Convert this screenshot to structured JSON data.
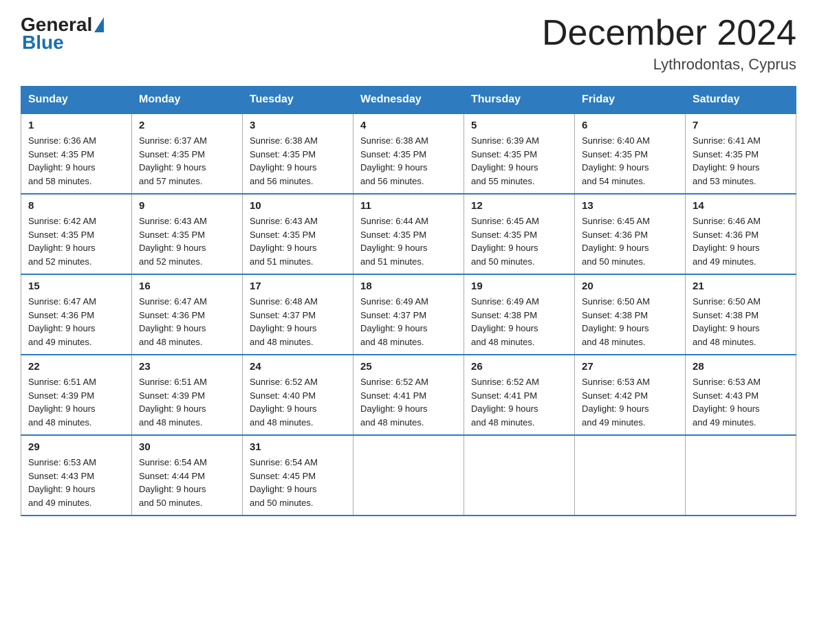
{
  "header": {
    "logo_line1": "General",
    "logo_line2": "Blue",
    "title": "December 2024",
    "subtitle": "Lythrodontas, Cyprus"
  },
  "weekdays": [
    "Sunday",
    "Monday",
    "Tuesday",
    "Wednesday",
    "Thursday",
    "Friday",
    "Saturday"
  ],
  "weeks": [
    [
      {
        "day": "1",
        "sunrise": "6:36 AM",
        "sunset": "4:35 PM",
        "daylight": "9 hours and 58 minutes."
      },
      {
        "day": "2",
        "sunrise": "6:37 AM",
        "sunset": "4:35 PM",
        "daylight": "9 hours and 57 minutes."
      },
      {
        "day": "3",
        "sunrise": "6:38 AM",
        "sunset": "4:35 PM",
        "daylight": "9 hours and 56 minutes."
      },
      {
        "day": "4",
        "sunrise": "6:38 AM",
        "sunset": "4:35 PM",
        "daylight": "9 hours and 56 minutes."
      },
      {
        "day": "5",
        "sunrise": "6:39 AM",
        "sunset": "4:35 PM",
        "daylight": "9 hours and 55 minutes."
      },
      {
        "day": "6",
        "sunrise": "6:40 AM",
        "sunset": "4:35 PM",
        "daylight": "9 hours and 54 minutes."
      },
      {
        "day": "7",
        "sunrise": "6:41 AM",
        "sunset": "4:35 PM",
        "daylight": "9 hours and 53 minutes."
      }
    ],
    [
      {
        "day": "8",
        "sunrise": "6:42 AM",
        "sunset": "4:35 PM",
        "daylight": "9 hours and 52 minutes."
      },
      {
        "day": "9",
        "sunrise": "6:43 AM",
        "sunset": "4:35 PM",
        "daylight": "9 hours and 52 minutes."
      },
      {
        "day": "10",
        "sunrise": "6:43 AM",
        "sunset": "4:35 PM",
        "daylight": "9 hours and 51 minutes."
      },
      {
        "day": "11",
        "sunrise": "6:44 AM",
        "sunset": "4:35 PM",
        "daylight": "9 hours and 51 minutes."
      },
      {
        "day": "12",
        "sunrise": "6:45 AM",
        "sunset": "4:35 PM",
        "daylight": "9 hours and 50 minutes."
      },
      {
        "day": "13",
        "sunrise": "6:45 AM",
        "sunset": "4:36 PM",
        "daylight": "9 hours and 50 minutes."
      },
      {
        "day": "14",
        "sunrise": "6:46 AM",
        "sunset": "4:36 PM",
        "daylight": "9 hours and 49 minutes."
      }
    ],
    [
      {
        "day": "15",
        "sunrise": "6:47 AM",
        "sunset": "4:36 PM",
        "daylight": "9 hours and 49 minutes."
      },
      {
        "day": "16",
        "sunrise": "6:47 AM",
        "sunset": "4:36 PM",
        "daylight": "9 hours and 48 minutes."
      },
      {
        "day": "17",
        "sunrise": "6:48 AM",
        "sunset": "4:37 PM",
        "daylight": "9 hours and 48 minutes."
      },
      {
        "day": "18",
        "sunrise": "6:49 AM",
        "sunset": "4:37 PM",
        "daylight": "9 hours and 48 minutes."
      },
      {
        "day": "19",
        "sunrise": "6:49 AM",
        "sunset": "4:38 PM",
        "daylight": "9 hours and 48 minutes."
      },
      {
        "day": "20",
        "sunrise": "6:50 AM",
        "sunset": "4:38 PM",
        "daylight": "9 hours and 48 minutes."
      },
      {
        "day": "21",
        "sunrise": "6:50 AM",
        "sunset": "4:38 PM",
        "daylight": "9 hours and 48 minutes."
      }
    ],
    [
      {
        "day": "22",
        "sunrise": "6:51 AM",
        "sunset": "4:39 PM",
        "daylight": "9 hours and 48 minutes."
      },
      {
        "day": "23",
        "sunrise": "6:51 AM",
        "sunset": "4:39 PM",
        "daylight": "9 hours and 48 minutes."
      },
      {
        "day": "24",
        "sunrise": "6:52 AM",
        "sunset": "4:40 PM",
        "daylight": "9 hours and 48 minutes."
      },
      {
        "day": "25",
        "sunrise": "6:52 AM",
        "sunset": "4:41 PM",
        "daylight": "9 hours and 48 minutes."
      },
      {
        "day": "26",
        "sunrise": "6:52 AM",
        "sunset": "4:41 PM",
        "daylight": "9 hours and 48 minutes."
      },
      {
        "day": "27",
        "sunrise": "6:53 AM",
        "sunset": "4:42 PM",
        "daylight": "9 hours and 49 minutes."
      },
      {
        "day": "28",
        "sunrise": "6:53 AM",
        "sunset": "4:43 PM",
        "daylight": "9 hours and 49 minutes."
      }
    ],
    [
      {
        "day": "29",
        "sunrise": "6:53 AM",
        "sunset": "4:43 PM",
        "daylight": "9 hours and 49 minutes."
      },
      {
        "day": "30",
        "sunrise": "6:54 AM",
        "sunset": "4:44 PM",
        "daylight": "9 hours and 50 minutes."
      },
      {
        "day": "31",
        "sunrise": "6:54 AM",
        "sunset": "4:45 PM",
        "daylight": "9 hours and 50 minutes."
      },
      null,
      null,
      null,
      null
    ]
  ],
  "labels": {
    "sunrise": "Sunrise:",
    "sunset": "Sunset:",
    "daylight": "Daylight:"
  }
}
